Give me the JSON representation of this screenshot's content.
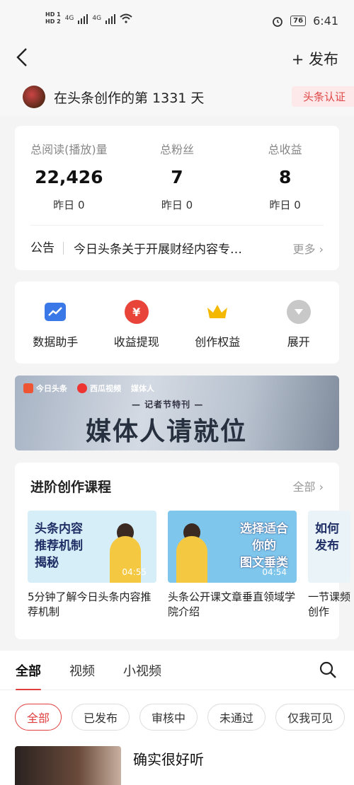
{
  "status_bar": {
    "signal_left": "HD 1",
    "signal_left2": "HD 2",
    "net1": "4G",
    "net2": "4G",
    "battery": "76",
    "time": "6:41"
  },
  "header": {
    "back": "<",
    "publish": "+ 发布"
  },
  "profile": {
    "days_text": "在头条创作的第 1331 天",
    "verify_badge": "头条认证"
  },
  "stats": {
    "items": [
      {
        "label": "总阅读(播放)量",
        "value": "22,426",
        "sub": "昨日 0"
      },
      {
        "label": "总粉丝",
        "value": "7",
        "sub": "昨日 0"
      },
      {
        "label": "总收益",
        "value": "8",
        "sub": "昨日 0"
      }
    ]
  },
  "notice": {
    "label": "公告",
    "text": "今日头条关于开展财经内容专…",
    "more": "更多 ›"
  },
  "tools": [
    {
      "label": "数据助手",
      "icon": "chart-icon",
      "color": "#3b78e7"
    },
    {
      "label": "收益提现",
      "icon": "yen-icon",
      "color": "#e8443a"
    },
    {
      "label": "创作权益",
      "icon": "crown-icon",
      "color": "#f5b800"
    },
    {
      "label": "展开",
      "icon": "expand-icon",
      "color": "#c8c8c8"
    }
  ],
  "banner": {
    "brand1": "今日头条",
    "brand2": "西瓜视频",
    "brand3": "媒体人",
    "subtitle": "— 记者节特刊 —",
    "title": "媒体人请就位"
  },
  "courses": {
    "title": "进阶创作课程",
    "more": "全部 ›",
    "items": [
      {
        "thumb_text": "头条内容\n推荐机制\n揭秘",
        "duration": "04:55",
        "title": "5分钟了解今日头条内容推荐机制"
      },
      {
        "thumb_text": "选择适合\n你的\n图文垂类",
        "duration": "04:54",
        "title": "头条公开课文章垂直领域学院介绍"
      },
      {
        "thumb_text": "如何\n发布",
        "duration": "",
        "title": "一节课频创作"
      }
    ]
  },
  "tabs": {
    "items": [
      "全部",
      "视频",
      "小视频"
    ],
    "active": 0
  },
  "filters": {
    "items": [
      "全部",
      "已发布",
      "审核中",
      "未通过",
      "仅我可见"
    ],
    "active": 0
  },
  "article": {
    "title": "确实很好听"
  }
}
